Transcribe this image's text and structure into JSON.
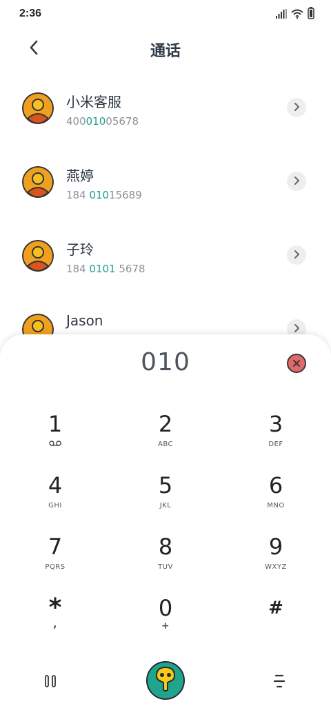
{
  "status_bar": {
    "time": "2:36"
  },
  "header": {
    "title": "通话"
  },
  "contacts": [
    {
      "name": "小米客服",
      "number_pre": "400",
      "number_hl": "010",
      "number_post": "05678"
    },
    {
      "name": "燕婷",
      "number_pre": "184 ",
      "number_hl": "010",
      "number_post": "15689"
    },
    {
      "name": "子玲",
      "number_pre": "184 ",
      "number_hl": "0101",
      "number_post": " 5678"
    },
    {
      "name": "Jason",
      "number_pre": "",
      "number_hl": "",
      "number_post": ""
    }
  ],
  "dialer": {
    "display_value": "010",
    "keys": [
      {
        "digit": "1",
        "sub": ""
      },
      {
        "digit": "2",
        "sub": "ABC"
      },
      {
        "digit": "3",
        "sub": "DEF"
      },
      {
        "digit": "4",
        "sub": "GHI"
      },
      {
        "digit": "5",
        "sub": "JKL"
      },
      {
        "digit": "6",
        "sub": "MNO"
      },
      {
        "digit": "7",
        "sub": "PQRS"
      },
      {
        "digit": "8",
        "sub": "TUV"
      },
      {
        "digit": "9",
        "sub": "WXYZ"
      },
      {
        "digit": "*",
        "sub": ","
      },
      {
        "digit": "0",
        "sub": "+"
      },
      {
        "digit": "#",
        "sub": ""
      }
    ]
  },
  "colors": {
    "accent": "#1aa089",
    "call_button": "#1fa48e",
    "clear_button": "#e06a68",
    "avatar_bg": "#f0a020",
    "avatar_body": "#d9541e"
  }
}
